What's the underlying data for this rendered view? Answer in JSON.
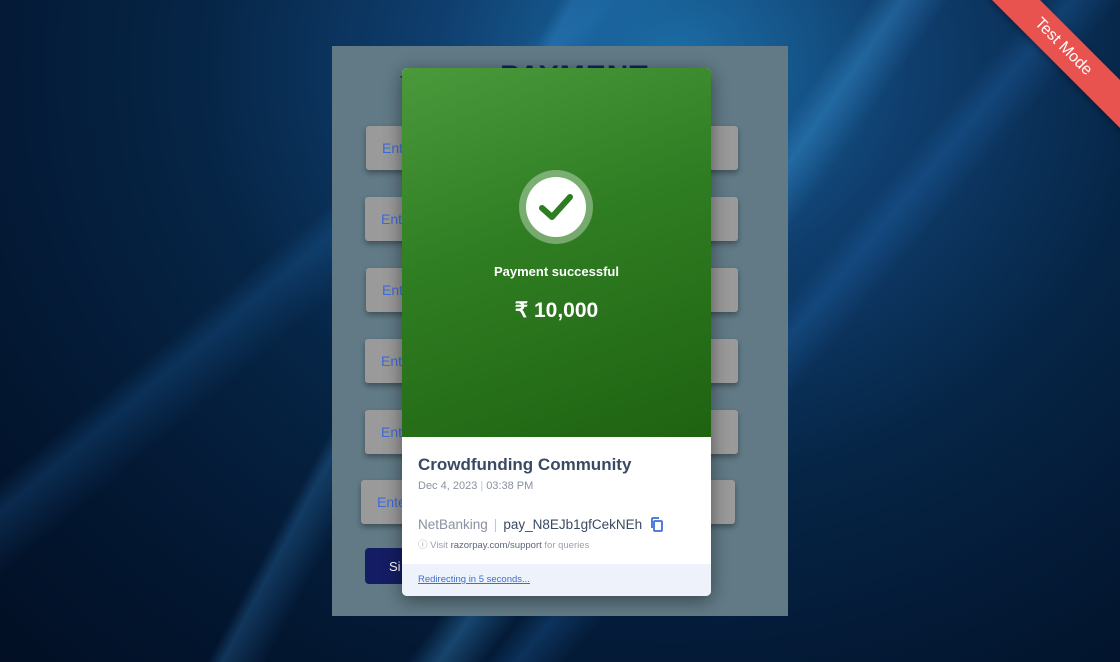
{
  "test_mode": {
    "label": "Test Mode",
    "color": "#e8524f"
  },
  "form": {
    "title": "PAYMENT",
    "fields": [
      {
        "placeholder": "Ent"
      },
      {
        "placeholder": "Ent"
      },
      {
        "placeholder": "Ent"
      },
      {
        "placeholder": "Ent"
      },
      {
        "placeholder": "Ent"
      },
      {
        "placeholder": "Ente"
      }
    ],
    "submit_label": "Si"
  },
  "modal": {
    "status": "Payment successful",
    "amount": "₹ 10,000",
    "merchant": "Crowdfunding Community",
    "date": "Dec 4, 2023",
    "time": "03:38 PM",
    "method": "NetBanking",
    "payment_id": "pay_N8EJb1gfCekNEh",
    "support_prefix": "Visit",
    "support_link": "razorpay.com/support",
    "support_suffix": "for queries",
    "redirect_text": "Redirecting in 5 seconds...",
    "success_color": "#2f7d22"
  }
}
